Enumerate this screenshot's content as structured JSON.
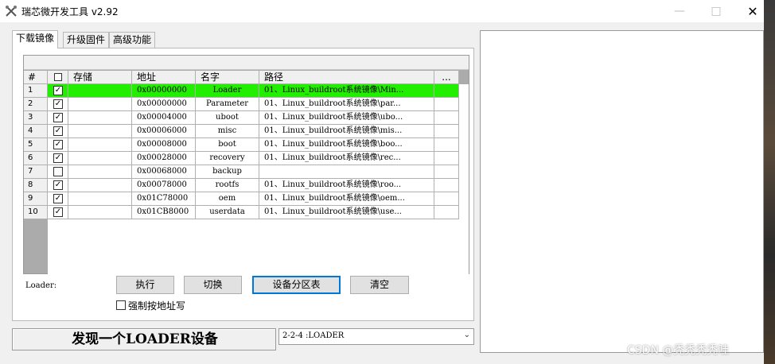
{
  "window": {
    "title": "瑞芯微开发工具 v2.92",
    "controls": {
      "minimize": "—",
      "maximize": "□",
      "close": "✕"
    }
  },
  "tabs": [
    {
      "label": "下载镜像",
      "active": true
    },
    {
      "label": "升级固件",
      "active": false
    },
    {
      "label": "高级功能",
      "active": false
    }
  ],
  "table": {
    "headers": {
      "num": "#",
      "check": "",
      "storage": "存储",
      "address": "地址",
      "name": "名字",
      "path": "路径",
      "more": "..."
    },
    "rows": [
      {
        "num": "1",
        "checked": true,
        "storage": "",
        "address": "0x00000000",
        "name": "Loader",
        "path": "01、Linux_buildroot系统镜像\\Min...",
        "highlight": true
      },
      {
        "num": "2",
        "checked": true,
        "storage": "",
        "address": "0x00000000",
        "name": "Parameter",
        "path": "01、Linux_buildroot系统镜像\\par...",
        "highlight": false
      },
      {
        "num": "3",
        "checked": true,
        "storage": "",
        "address": "0x00004000",
        "name": "uboot",
        "path": "01、Linux_buildroot系统镜像\\ubo...",
        "highlight": false
      },
      {
        "num": "4",
        "checked": true,
        "storage": "",
        "address": "0x00006000",
        "name": "misc",
        "path": "01、Linux_buildroot系统镜像\\mis...",
        "highlight": false
      },
      {
        "num": "5",
        "checked": true,
        "storage": "",
        "address": "0x00008000",
        "name": "boot",
        "path": "01、Linux_buildroot系统镜像\\boo...",
        "highlight": false
      },
      {
        "num": "6",
        "checked": true,
        "storage": "",
        "address": "0x00028000",
        "name": "recovery",
        "path": "01、Linux_buildroot系统镜像\\rec...",
        "highlight": false
      },
      {
        "num": "7",
        "checked": false,
        "storage": "",
        "address": "0x00068000",
        "name": "backup",
        "path": "",
        "highlight": false
      },
      {
        "num": "8",
        "checked": true,
        "storage": "",
        "address": "0x00078000",
        "name": "rootfs",
        "path": "01、Linux_buildroot系统镜像\\roo...",
        "highlight": false
      },
      {
        "num": "9",
        "checked": true,
        "storage": "",
        "address": "0x01C78000",
        "name": "oem",
        "path": "01、Linux_buildroot系统镜像\\oem...",
        "highlight": false
      },
      {
        "num": "10",
        "checked": true,
        "storage": "",
        "address": "0x01CB8000",
        "name": "userdata",
        "path": "01、Linux_buildroot系统镜像\\use...",
        "highlight": false
      }
    ]
  },
  "controls": {
    "loader_label": "Loader:",
    "exec_button": "执行",
    "switch_button": "切换",
    "partition_button": "设备分区表",
    "clear_button": "清空",
    "force_address_label": "强制按地址写",
    "force_address_checked": false
  },
  "status": {
    "message": "发现一个LOADER设备",
    "device_selected": "2-2-4 :LOADER"
  },
  "watermark": "CSDN @秃秃秃秃哇",
  "colors": {
    "highlight": "#22ee00",
    "default_button_border": "#0078d7"
  }
}
